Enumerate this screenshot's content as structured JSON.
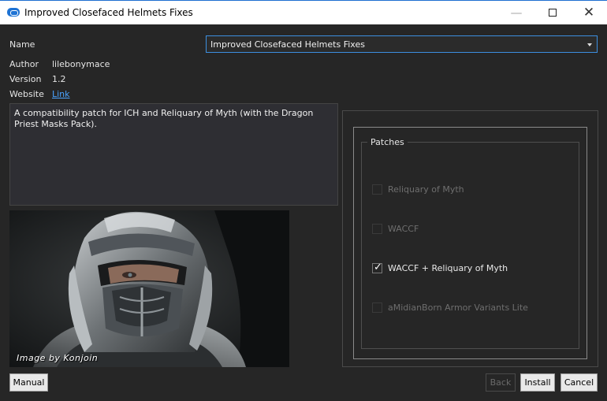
{
  "window": {
    "title": "Improved Closefaced Helmets Fixes",
    "minimize_icon": "minimize-icon",
    "maximize_icon": "maximize-icon",
    "close_icon": "close-icon"
  },
  "info": {
    "name_label": "Name",
    "name_value": "Improved Closefaced Helmets Fixes",
    "author_label": "Author",
    "author_value": "lilebonymace",
    "version_label": "Version",
    "version_value": "1.2",
    "website_label": "Website",
    "website_link": "Link"
  },
  "description": "A compatibility patch for ICH and Reliquary of Myth (with the Dragon Priest Masks Pack).",
  "preview": {
    "caption": "Image by Konjoin"
  },
  "patches": {
    "title": "Patches",
    "items": [
      {
        "label": "Reliquary of Myth",
        "checked": false,
        "enabled": false
      },
      {
        "label": "WACCF",
        "checked": false,
        "enabled": false
      },
      {
        "label": "WACCF + Reliquary of Myth",
        "checked": true,
        "enabled": true
      },
      {
        "label": "aMidianBorn Armor Variants Lite",
        "checked": false,
        "enabled": false
      }
    ]
  },
  "buttons": {
    "manual": "Manual",
    "back": "Back",
    "install": "Install",
    "cancel": "Cancel"
  },
  "colors": {
    "background": "#262626",
    "accent": "#3c8fe0",
    "link": "#4aa3ff"
  }
}
